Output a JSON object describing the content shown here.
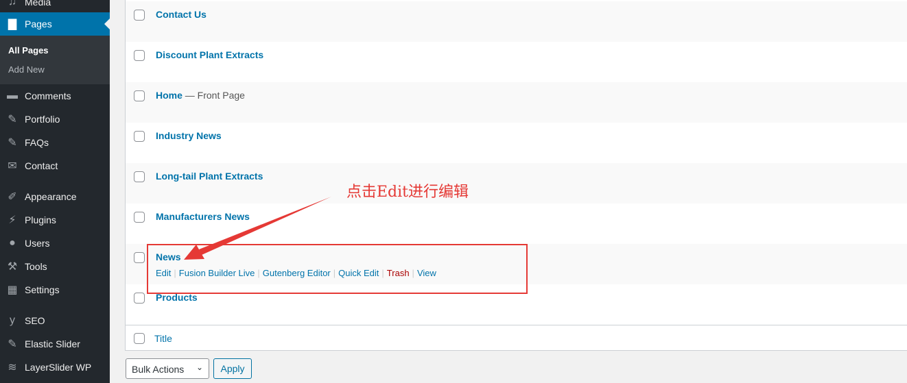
{
  "sidebar": {
    "items": [
      {
        "label": "Media",
        "icon": "media-icon"
      },
      {
        "label": "Pages",
        "icon": "pages-icon",
        "active": true
      },
      {
        "label": "Comments",
        "icon": "comments-icon"
      },
      {
        "label": "Portfolio",
        "icon": "pin-icon"
      },
      {
        "label": "FAQs",
        "icon": "pin-icon"
      },
      {
        "label": "Contact",
        "icon": "mail-icon"
      },
      {
        "label": "Appearance",
        "icon": "brush-icon"
      },
      {
        "label": "Plugins",
        "icon": "plug-icon"
      },
      {
        "label": "Users",
        "icon": "user-icon"
      },
      {
        "label": "Tools",
        "icon": "wrench-icon"
      },
      {
        "label": "Settings",
        "icon": "settings-icon"
      },
      {
        "label": "SEO",
        "icon": "yoast-icon"
      },
      {
        "label": "Elastic Slider",
        "icon": "pin-icon"
      },
      {
        "label": "LayerSlider WP",
        "icon": "layers-icon"
      }
    ],
    "submenu": [
      "All Pages",
      "Add New"
    ]
  },
  "pages": [
    {
      "title": "Contact Us"
    },
    {
      "title": "Discount Plant Extracts"
    },
    {
      "title": "Home",
      "state": "— Front Page"
    },
    {
      "title": "Industry News"
    },
    {
      "title": "Long-tail Plant Extracts"
    },
    {
      "title": "Manufacturers News"
    },
    {
      "title": "News",
      "actions": [
        "Edit",
        "Fusion Builder Live",
        "Gutenberg Editor",
        "Quick Edit",
        "Trash",
        "View"
      ]
    },
    {
      "title": "Products"
    }
  ],
  "footer": {
    "column": "Title"
  },
  "bulk": {
    "selected": "Bulk Actions",
    "apply": "Apply"
  },
  "annotation": {
    "text": "点击Edit进行编辑",
    "color": "#e53935"
  }
}
